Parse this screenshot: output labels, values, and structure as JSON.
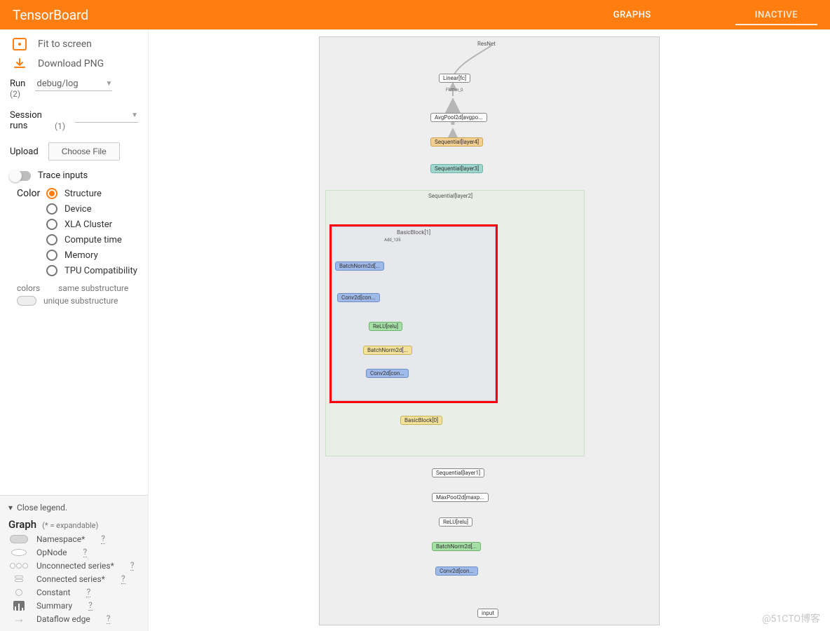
{
  "header": {
    "title": "TensorBoard",
    "tab_graphs": "GRAPHS",
    "tab_inactive": "INACTIVE"
  },
  "sidebar": {
    "fit_label": "Fit to screen",
    "download_label": "Download PNG",
    "run_label": "Run",
    "run_count": "(2)",
    "run_value": "debug/log",
    "session_label": "Session runs",
    "session_count": "(1)",
    "upload_label": "Upload",
    "upload_button": "Choose File",
    "trace_label": "Trace inputs",
    "color_label": "Color",
    "color_options": [
      "Structure",
      "Device",
      "XLA Cluster",
      "Compute time",
      "Memory",
      "TPU Compatibility"
    ],
    "colors_word": "colors",
    "same_sub": "same substructure",
    "unique_sub": "unique substructure"
  },
  "legend": {
    "close": "Close legend.",
    "title": "Graph",
    "expandable": "(* = expandable)",
    "namespace": "Namespace*",
    "opnode": "OpNode",
    "unconnected": "Unconnected series*",
    "connected": "Connected series*",
    "constant": "Constant",
    "summary": "Summary",
    "dataflow": "Dataflow edge",
    "q": "?"
  },
  "graph": {
    "scope_label": "ResNet",
    "group_label": "Sequential[layer2]",
    "inner_label": "BasicBlock[1]",
    "inner_sub": "Add_135",
    "nodes": {
      "linear": "Linear[fc]",
      "flatten": "Flatten_0",
      "avgpool": "AvgPool2d[avgpo...",
      "seq4": "Sequential[layer4]",
      "seq3": "Sequential[layer3]",
      "bn1": "BatchNorm2d[...",
      "conv2a": "Conv2d[con...",
      "relu_in": "ReLU[relu]",
      "bn2": "BatchNorm2d[...",
      "conv2b": "Conv2d[con...",
      "bb0": "BasicBlock[0]",
      "seq1": "Sequential[layer1]",
      "maxpool": "MaxPool2d[maxp...",
      "relu_out": "ReLU[relu]",
      "bn_out": "BatchNorm2d[...",
      "conv_out": "Conv2d[con...",
      "input": "input"
    }
  },
  "watermark": "@51CTO博客"
}
